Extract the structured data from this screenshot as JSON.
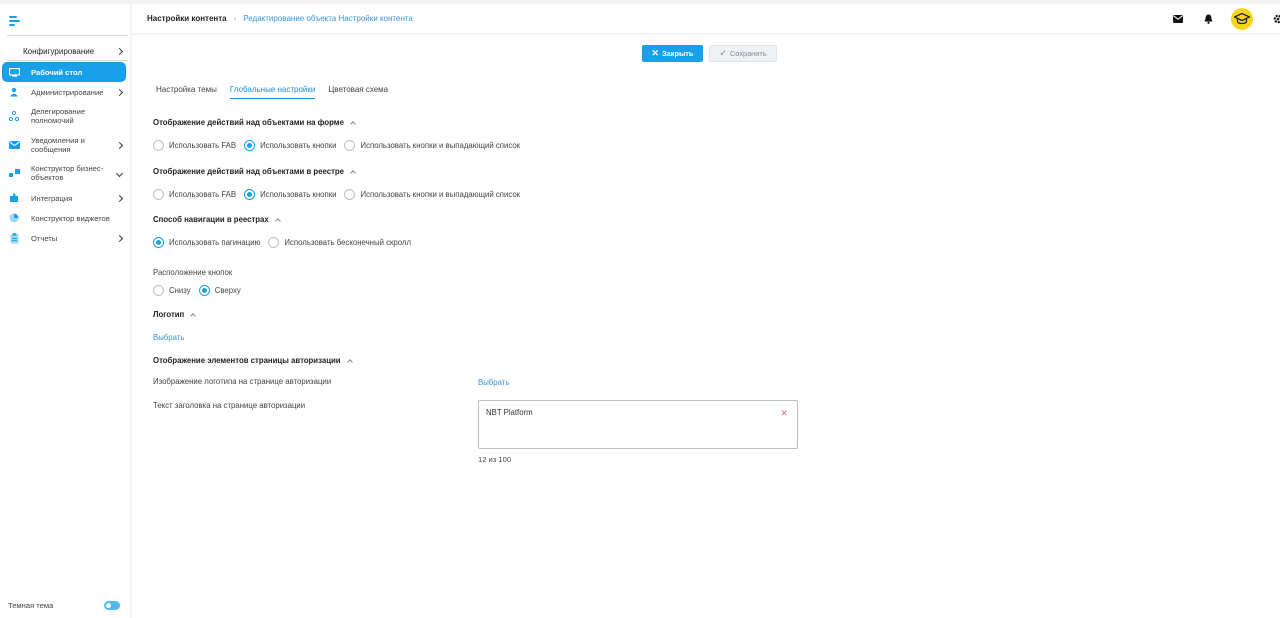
{
  "sidebar": {
    "section_label": "Конфигурирование",
    "items": [
      {
        "label": "Рабочий стол"
      },
      {
        "label": "Администрирование"
      },
      {
        "label": "Делегирование полномочий"
      },
      {
        "label": "Уведомления и сообщения"
      },
      {
        "label": "Конструктор бизнес-объектов"
      },
      {
        "label": "Интеграция"
      },
      {
        "label": "Конструктор виджетов"
      },
      {
        "label": "Отчеты"
      }
    ],
    "dark_theme_label": "Темная тема"
  },
  "header": {
    "breadcrumb_root": "Настройки контента",
    "breadcrumb_sep": "›",
    "breadcrumb_current": "Редактирование объекта Настройки контента"
  },
  "toolbar": {
    "close_label": "Закрыть",
    "save_label": "Сохранить"
  },
  "tabs": [
    {
      "label": "Настройка темы"
    },
    {
      "label": "Глобальные настройки"
    },
    {
      "label": "Цветовая схема"
    }
  ],
  "sections": {
    "form_actions": {
      "title": "Отображение действий над объектами на форме",
      "options": [
        "Использовать FAB",
        "Использовать кнопки",
        "Использовать кнопки и выпадающий список"
      ],
      "selected": "Использовать кнопки"
    },
    "registry_actions": {
      "title": "Отображение действий над объектами в реестре",
      "options": [
        "Использовать FAB",
        "Использовать кнопки",
        "Использовать кнопки и выпадающий список"
      ],
      "selected": "Использовать кнопки"
    },
    "navigation": {
      "title": "Способ навигации в реестрах",
      "options": [
        "Использовать пагинацию",
        "Использовать бесконечный скролл"
      ],
      "selected": "Использовать пагинацию"
    },
    "buttons_position": {
      "title": "Расположение кнопок",
      "options": [
        "Снизу",
        "Сверху"
      ],
      "selected": "Сверху"
    },
    "logo": {
      "title": "Логотип",
      "choose_label": "Выбрать"
    },
    "auth_page": {
      "title": "Отображение элементов страницы авторизации",
      "logo_label": "Изображение логотипа на странице авторизации",
      "logo_choose": "Выбрать",
      "header_text_label": "Текст заголовка на странице авторизации",
      "header_text_value": "NBT Platform",
      "counter": "12 из 100"
    }
  },
  "colors": {
    "accent": "#1aa0e8",
    "link": "#3a95d8",
    "avatar": "#f4d71a",
    "clear": "#e57373"
  }
}
